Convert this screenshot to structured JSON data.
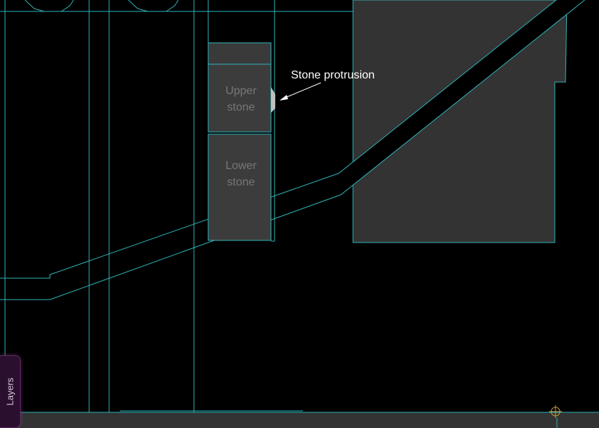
{
  "canvas": {
    "background": "#000000",
    "line_color": "#2fb3b8",
    "fill_color": "#333333"
  },
  "stones": {
    "upper_line1": "Upper",
    "upper_line2": "stone",
    "lower_line1": "Lower",
    "lower_line2": "stone"
  },
  "annotation": {
    "label": "Stone protrusion"
  },
  "layers_tab": {
    "label": "Layers",
    "background": "#2b0f2e"
  },
  "icons": {
    "origin_marker": "crosshair-icon"
  }
}
